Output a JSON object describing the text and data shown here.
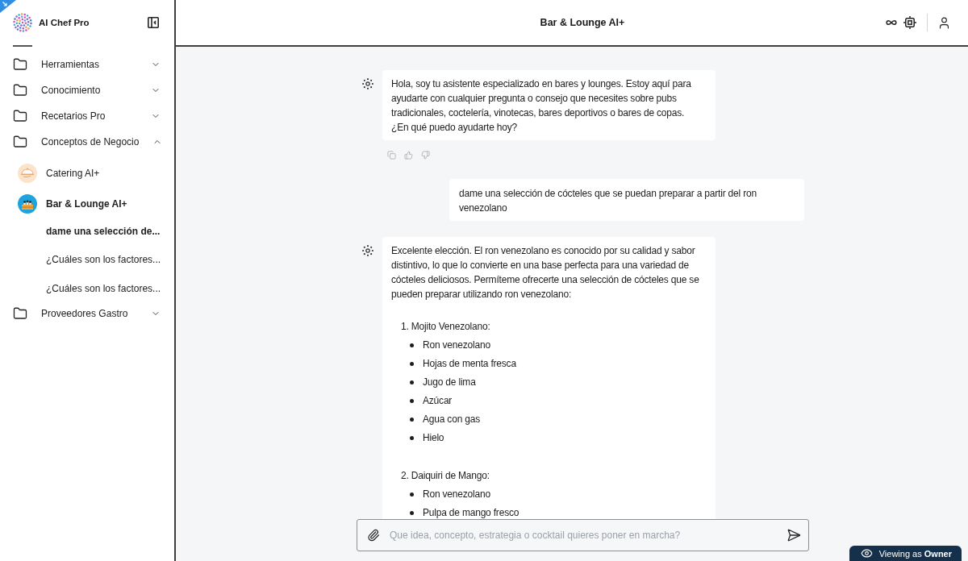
{
  "sidebar": {
    "title": "AI Chef Pro",
    "folders": [
      {
        "label": "Herramientas",
        "expanded": false
      },
      {
        "label": "Conocimiento",
        "expanded": false
      },
      {
        "label": "Recetarios Pro",
        "expanded": false
      },
      {
        "label": "Conceptos de Negocio",
        "expanded": true,
        "children": [
          {
            "label": "Catering AI+",
            "selected": false
          },
          {
            "label": "Bar & Lounge AI+",
            "selected": true,
            "children": [
              {
                "label": "dame una selección de...",
                "selected": true
              },
              {
                "label": "¿Cuáles son los factores...",
                "selected": false
              },
              {
                "label": "¿Cuáles son los factores...",
                "selected": false
              }
            ]
          }
        ]
      },
      {
        "label": "Proveedores Gastro",
        "expanded": false
      }
    ]
  },
  "header": {
    "title": "Bar & Lounge AI+"
  },
  "messages": [
    {
      "kind": "assistant",
      "feedback_bar": true,
      "text": "Hola, soy tu asistente especializado en bares y lounges. Estoy aquí para ayudarte con cualquier pregunta o consejo que necesites sobre pubs tradicionales, coctelería, vinotecas, bares deportivos o bares de copas. ¿En qué puedo ayudarte hoy?"
    },
    {
      "kind": "user",
      "text": "dame una selección de cócteles que se puedan preparar a partir del ron venezolano"
    },
    {
      "kind": "assistant",
      "feedback_bar": false,
      "text": "Excelente elección. El ron venezolano es conocido por su calidad y sabor distintivo, lo que lo convierte en una base perfecta para una variedad de cócteles deliciosos. Permíteme ofrecerte una selección de cócteles que se pueden preparar utilizando ron venezolano:",
      "list": [
        {
          "heading": "1. Mojito Venezolano:",
          "items": [
            "Ron venezolano",
            "Hojas de menta fresca",
            "Jugo de lima",
            "Azúcar",
            "Agua con gas",
            "Hielo"
          ]
        },
        {
          "heading": "2. Daiquiri de Mango:",
          "items": [
            "Ron venezolano",
            "Pulpa de mango fresco"
          ]
        }
      ]
    }
  ],
  "composer": {
    "placeholder": "Que idea, concepto, estrategia o cocktail quieres poner en marcha?"
  },
  "viewing_badge": "Viewing as **Owner**"
}
